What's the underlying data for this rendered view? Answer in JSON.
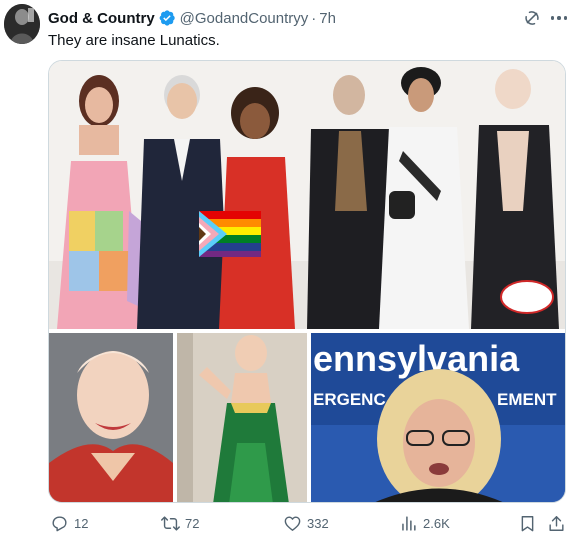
{
  "post": {
    "author_name": "God & Country",
    "handle": "@GodandCountryy",
    "separator": "·",
    "timestamp": "7h",
    "text": "They are insane Lunatics."
  },
  "media": {
    "sign_line_1": "ennsylvania",
    "sign_line_2": "ERGENC",
    "sign_line_3": "EMENT"
  },
  "actions": {
    "replies": "12",
    "reposts": "72",
    "likes": "332",
    "views": "2.6K"
  },
  "colors": {
    "verified_blue": "#1d9bf0",
    "secondary_text": "#536471",
    "primary_text": "#0f1419",
    "divider": "#cfd9de"
  },
  "icons": {
    "verified": "verified-badge-icon",
    "grok": "grok-icon",
    "more": "more-icon",
    "reply": "reply-icon",
    "repost": "repost-icon",
    "like": "heart-icon",
    "views": "views-chart-icon",
    "bookmark": "bookmark-icon",
    "share": "share-icon"
  }
}
